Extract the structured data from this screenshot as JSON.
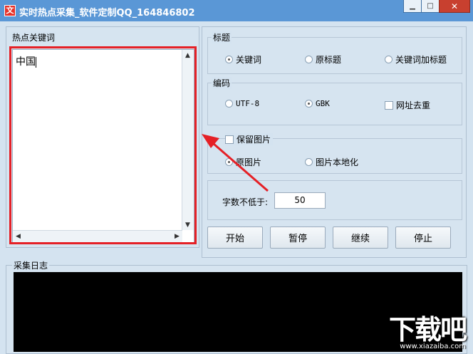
{
  "window": {
    "title": "实时热点采集_软件定制QQ_164846802",
    "app_icon_glyph": "文",
    "minimize_glyph": "▁",
    "maximize_glyph": "□",
    "close_glyph": "✕"
  },
  "keywords_panel": {
    "label": "热点关键词",
    "text": "中国"
  },
  "title_group": {
    "label": "标题",
    "options": [
      "关键词",
      "原标题",
      "关键词加标题"
    ],
    "selected": "关键词"
  },
  "encoding_group": {
    "label": "编码",
    "options": [
      "UTF-8",
      "GBK"
    ],
    "selected": "GBK",
    "dedupe_label": "网址去重",
    "dedupe_checked": false
  },
  "image_group": {
    "keep_label": "保留图片",
    "keep_checked": false,
    "options": [
      "原图片",
      "图片本地化"
    ],
    "selected": "原图片"
  },
  "min_chars": {
    "label": "字数不低于:",
    "value": "50"
  },
  "buttons": {
    "start": "开始",
    "pause": "暂停",
    "resume": "继续",
    "stop": "停止"
  },
  "log_panel": {
    "label": "采集日志"
  },
  "watermark": {
    "text": "下载吧",
    "url": "www.xiazaiba.com"
  },
  "colors": {
    "titlebar": "#5a97d6",
    "highlight": "#e52026",
    "background": "#d4e3f0"
  }
}
